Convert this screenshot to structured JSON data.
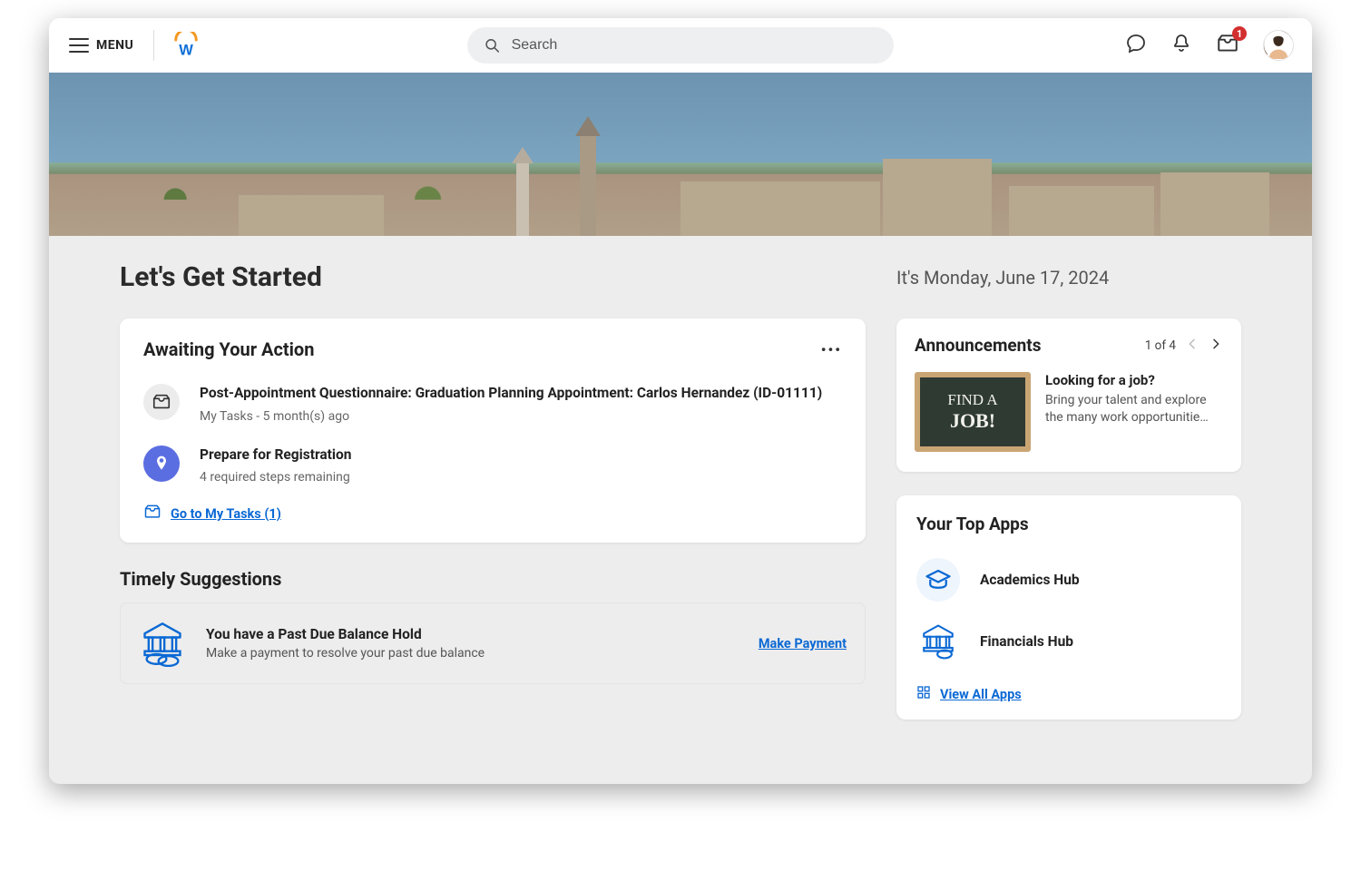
{
  "header": {
    "menu_label": "MENU",
    "search_placeholder": "Search",
    "inbox_badge": "1"
  },
  "page": {
    "title": "Let's Get Started",
    "date_text": "It's Monday, June 17, 2024"
  },
  "awaiting": {
    "title": "Awaiting Your Action",
    "items": [
      {
        "title": "Post-Appointment Questionnaire: Graduation Planning Appointment: Carlos Hernandez (ID-01111)",
        "sub": "My Tasks - 5 month(s) ago",
        "icon": "inbox"
      },
      {
        "title": "Prepare for Registration",
        "sub": "4 required steps remaining",
        "icon": "pin"
      }
    ],
    "link_label": "Go to My Tasks (1)"
  },
  "suggestions": {
    "title": "Timely Suggestions",
    "items": [
      {
        "title": "You have a Past Due Balance Hold",
        "sub": "Make a payment to resolve your past due balance",
        "action": "Make Payment"
      }
    ]
  },
  "announcements": {
    "title": "Announcements",
    "pager": "1 of 4",
    "chalk_line1": "FIND A",
    "chalk_line2": "JOB!",
    "item_title": "Looking for a job?",
    "item_sub": "Bring your talent and explore the many work opportunitie…"
  },
  "apps": {
    "title": "Your Top Apps",
    "items": [
      {
        "label": "Academics Hub"
      },
      {
        "label": "Financials Hub"
      }
    ],
    "view_all": "View All Apps"
  }
}
